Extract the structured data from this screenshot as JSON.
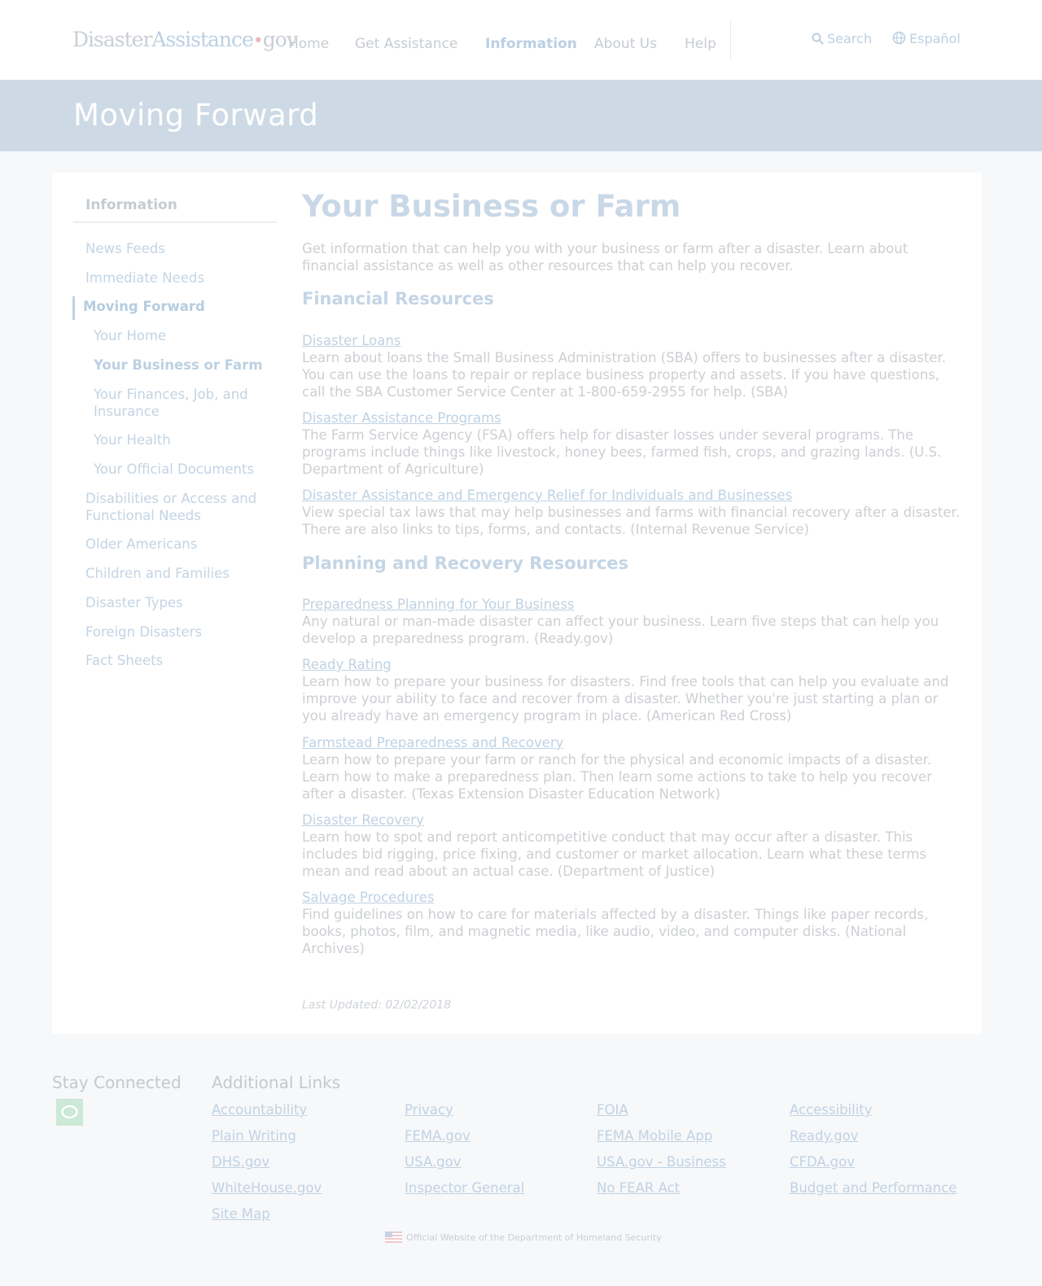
{
  "header": {
    "logo_disaster": "Disaster",
    "logo_assistance": "Assistance",
    "logo_dot": "•",
    "logo_gov": "gov",
    "nav": {
      "home": "Home",
      "get_assistance": "Get Assistance",
      "information": "Information",
      "about_us": "About Us",
      "help": "Help"
    },
    "search": "Search",
    "espanol": "Español"
  },
  "banner": {
    "title": "Moving Forward"
  },
  "sidebar": {
    "title": "Information",
    "items": [
      "News Feeds",
      "Immediate Needs",
      "Moving Forward",
      "Your Home",
      "Your Business or Farm",
      "Your Finances, Job, and Insurance",
      "Your Health",
      "Your Official Documents",
      "Disabilities or Access and Functional Needs",
      "Older Americans",
      "Children and Families",
      "Disaster Types",
      "Foreign Disasters",
      "Fact Sheets"
    ]
  },
  "main": {
    "title": "Your Business or Farm",
    "intro": "Get information that can help you with your business or farm after a disaster. Learn about financial assistance as well as other resources that can help you recover.",
    "financial": {
      "heading": "Financial Resources",
      "resources": [
        {
          "link": "Disaster Loans",
          "desc": "Learn about loans the Small Business Administration (SBA) offers to businesses after a disaster. You can use the loans to repair or replace business property and assets. If you have questions, call the SBA Customer Service Center at 1-800-659-2955 for help. (SBA)"
        },
        {
          "link": "Disaster Assistance Programs",
          "desc": "The Farm Service Agency (FSA) offers help for disaster losses under several programs. The programs include things like livestock, honey bees, farmed fish, crops, and grazing lands. (U.S. Department of Agriculture)"
        },
        {
          "link": "Disaster Assistance and Emergency Relief for Individuals and Businesses",
          "desc": "View special tax laws that may help businesses and farms with financial recovery after a disaster. There are also links to tips, forms, and contacts. (Internal Revenue Service)"
        }
      ]
    },
    "planning": {
      "heading": "Planning and Recovery Resources",
      "resources": [
        {
          "link": "Preparedness Planning for Your Business",
          "desc": "Any natural or man-made disaster can affect your business. Learn five steps that can help you develop a preparedness program. (Ready.gov)"
        },
        {
          "link": "Ready Rating",
          "desc": "Learn how to prepare your business for disasters. Find free tools that can help you evaluate and improve your ability to face and recover from a disaster. Whether you're just starting a plan or you already have an emergency program in place. (American Red Cross)"
        },
        {
          "link": "Farmstead Preparedness and Recovery",
          "desc": "Learn how to prepare your farm or ranch for the physical and economic impacts of a disaster. Learn how to make a preparedness plan. Then learn some actions to take to help you recover after a disaster. (Texas Extension Disaster Education Network)"
        },
        {
          "link": "Disaster Recovery",
          "desc": "Learn how to spot and report anticompetitive conduct that may occur after a disaster. This includes bid rigging, price fixing, and customer or market allocation. Learn what these terms mean and read about an actual case. (Department of Justice)"
        },
        {
          "link": "Salvage Procedures",
          "desc": "Find guidelines on how to care for materials affected by a disaster. Things like paper records, books, photos, film, and magnetic media, like audio, video, and computer disks. (National Archives)"
        }
      ]
    },
    "last_updated": "Last Updated: 02/02/2018"
  },
  "footer": {
    "stay_connected": "Stay Connected",
    "additional_links_title": "Additional Links",
    "links": [
      [
        "Accountability",
        "Privacy",
        "FOIA",
        "Accessibility"
      ],
      [
        "Plain Writing",
        "FEMA.gov",
        "FEMA Mobile App",
        "Ready.gov"
      ],
      [
        "DHS.gov",
        "USA.gov",
        "USA.gov - Business",
        "CFDA.gov"
      ],
      [
        "WhiteHouse.gov",
        "Inspector General",
        "No FEAR Act",
        "Budget and Performance"
      ],
      [
        "Site Map"
      ]
    ],
    "official": "Official Website of the Department of Homeland Security"
  }
}
